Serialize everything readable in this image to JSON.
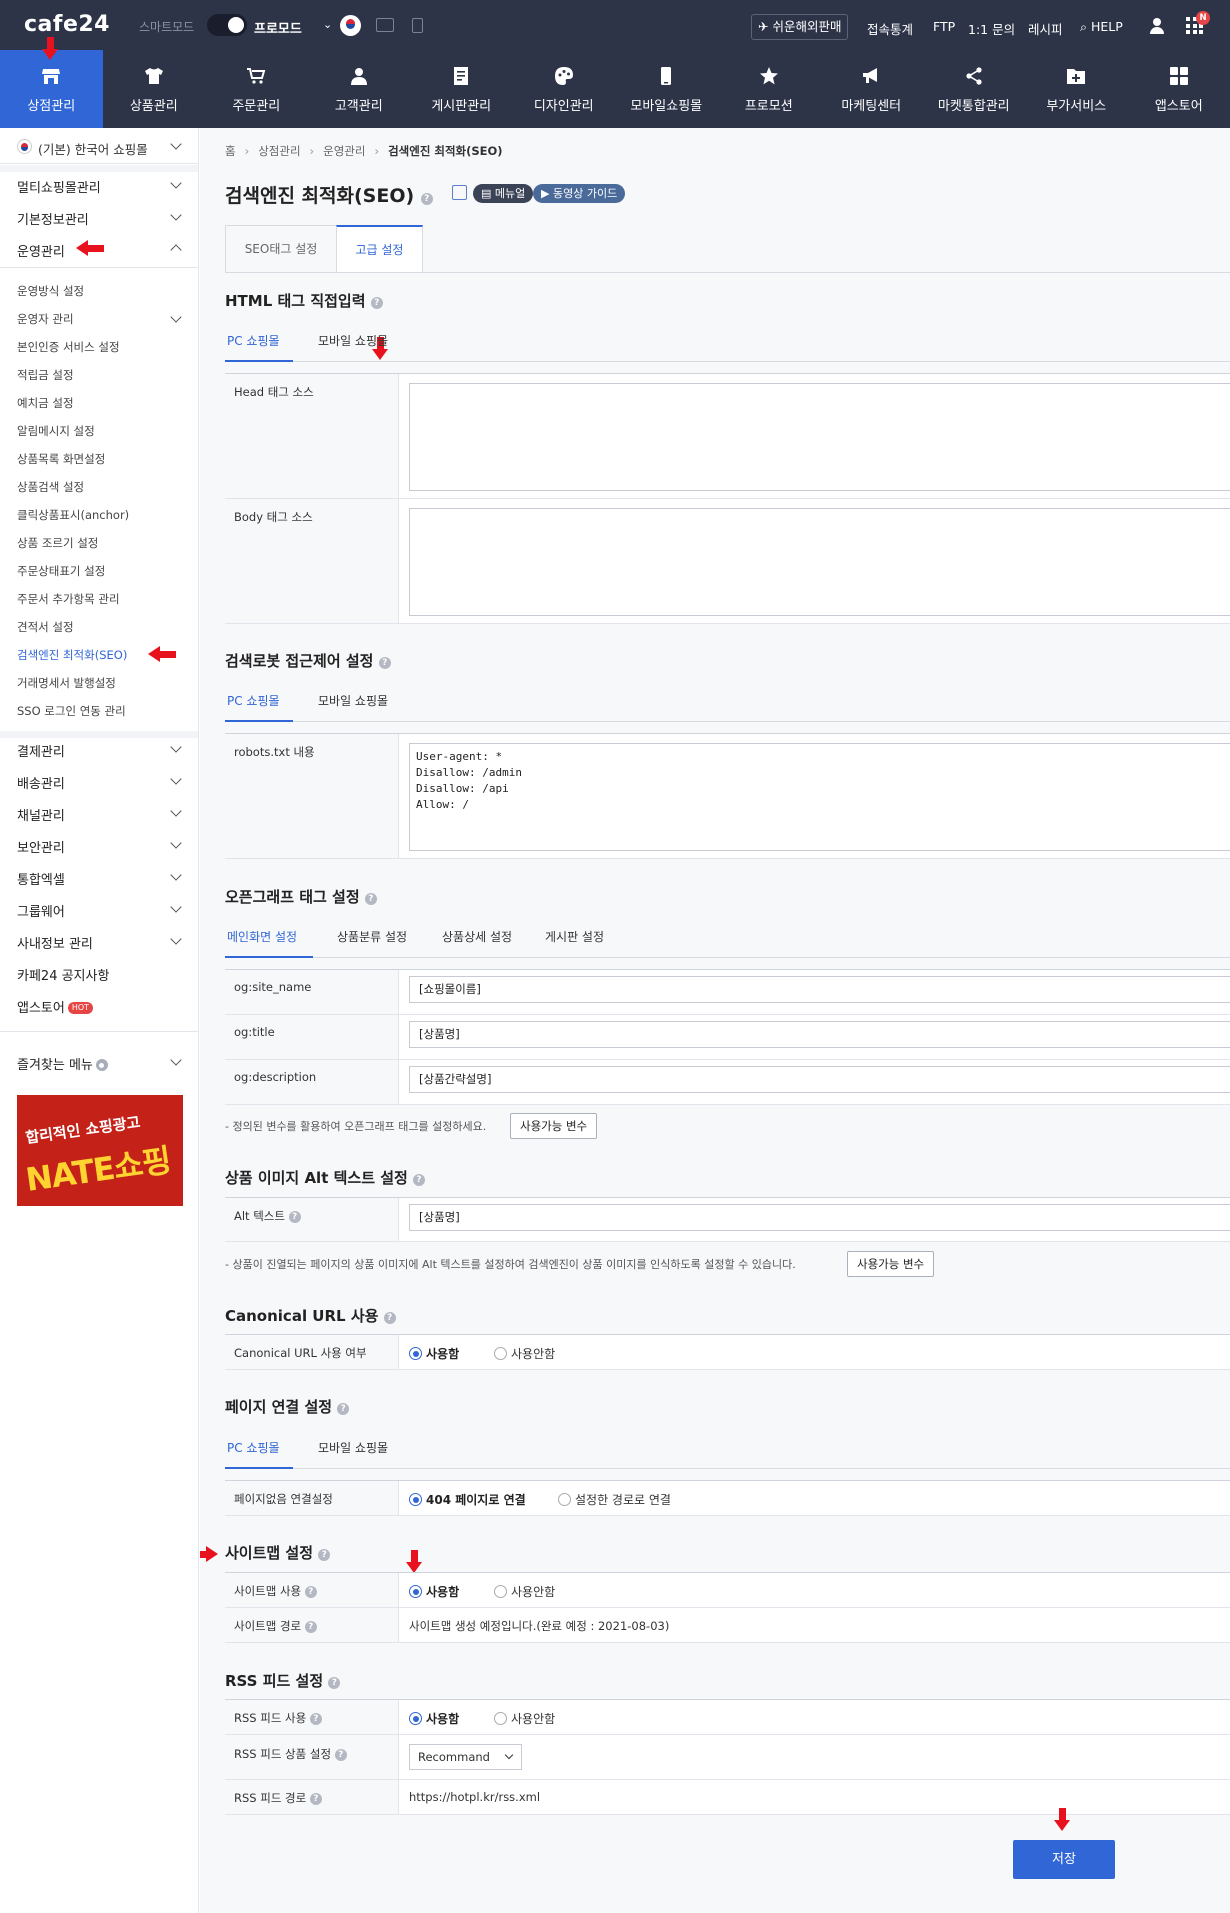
{
  "topbar": {
    "logo": "cafe24",
    "smart_mode": "스마트모드",
    "pro_mode": "프로모드",
    "quick_sell": "쉬운해외판매",
    "links": [
      "접속통계",
      "FTP",
      "1:1 문의",
      "레시피",
      "HELP"
    ],
    "notification_badge": "N"
  },
  "nav": {
    "items": [
      {
        "label": "상점관리",
        "icon": "store-icon"
      },
      {
        "label": "상품관리",
        "icon": "shirt-icon"
      },
      {
        "label": "주문관리",
        "icon": "cart-icon"
      },
      {
        "label": "고객관리",
        "icon": "person-icon"
      },
      {
        "label": "게시판관리",
        "icon": "board-icon"
      },
      {
        "label": "디자인관리",
        "icon": "palette-icon"
      },
      {
        "label": "모바일쇼핑몰",
        "icon": "mobile-icon"
      },
      {
        "label": "프로모션",
        "icon": "star-icon"
      },
      {
        "label": "마케팅센터",
        "icon": "megaphone-icon"
      },
      {
        "label": "마켓통합관리",
        "icon": "share-icon"
      },
      {
        "label": "부가서비스",
        "icon": "folder-plus-icon"
      },
      {
        "label": "앱스토어",
        "icon": "apps-icon"
      }
    ]
  },
  "sidebar": {
    "shop_select": "(기본) 한국어 쇼핑몰",
    "menus_top": [
      "멀티쇼핑몰관리",
      "기본정보관리",
      "운영관리"
    ],
    "sub_items": [
      "운영방식 설정",
      "운영자 관리",
      "본인인증 서비스 설정",
      "적립금 설정",
      "예치금 설정",
      "알림메시지 설정",
      "상품목록 화면설정",
      "상품검색 설정",
      "클릭상품표시(anchor)",
      "상품 조르기 설정",
      "주문상태표기 설정",
      "주문서 추가항목 관리",
      "견적서 설정",
      "검색엔진 최적화(SEO)",
      "거래명세서 발행설정",
      "SSO 로그인 연동 관리"
    ],
    "menus_bottom": [
      "결제관리",
      "배송관리",
      "채널관리",
      "보안관리",
      "통합엑셀",
      "그룹웨어",
      "사내정보 관리",
      "카페24 공지사항",
      "앱스토어"
    ],
    "hot_badge": "HOT",
    "favorites": "즐겨찾는 메뉴",
    "banner_line1": "합리적인 쇼핑광고",
    "banner_line2": "NATE쇼핑"
  },
  "breadcrumb": [
    "홈",
    "상점관리",
    "운영관리",
    "검색엔진 최적화(SEO)"
  ],
  "page": {
    "title": "검색엔진 최적화(SEO)",
    "manual_pill": "메뉴얼",
    "video_pill": "동영상 가이드",
    "tabs": [
      "SEO태그 설정",
      "고급 설정"
    ]
  },
  "html_tag": {
    "title": "HTML 태그 직접입력",
    "subtabs": [
      "PC 쇼핑몰",
      "모바일 쇼핑몰"
    ],
    "head_label": "Head 태그 소스",
    "head_value": "",
    "body_label": "Body 태그 소스",
    "body_value": ""
  },
  "robots": {
    "title": "검색로봇 접근제어 설정",
    "subtabs": [
      "PC 쇼핑몰",
      "모바일 쇼핑몰"
    ],
    "label": "robots.txt 내용",
    "content": "User-agent: *\nDisallow: /admin\nDisallow: /api\nAllow: /"
  },
  "opengraph": {
    "title": "오픈그래프 태그 설정",
    "subtabs": [
      "메인화면 설정",
      "상품분류 설정",
      "상품상세 설정",
      "게시판 설정"
    ],
    "rows": [
      {
        "label": "og:site_name",
        "value": "[쇼핑몰이름]"
      },
      {
        "label": "og:title",
        "value": "[상품명]"
      },
      {
        "label": "og:description",
        "value": "[상품간략설명]"
      }
    ],
    "note": "- 정의된 변수를 활용하여 오픈그래프 태그를 설정하세요.",
    "var_button": "사용가능 변수"
  },
  "alt_text": {
    "title": "상품 이미지 Alt 텍스트 설정",
    "label": "Alt 텍스트",
    "value": "[상품명]",
    "note": "- 상품이 진열되는 페이지의 상품 이미지에 Alt 텍스트를 설정하여 검색엔진이 상품 이미지를 인식하도록 설정할 수 있습니다.",
    "var_button": "사용가능 변수"
  },
  "canonical": {
    "title": "Canonical URL 사용",
    "label": "Canonical URL 사용 여부",
    "options": [
      "사용함",
      "사용안함"
    ],
    "selected": 0
  },
  "page_link": {
    "title": "페이지 연결 설정",
    "subtabs": [
      "PC 쇼핑몰",
      "모바일 쇼핑몰"
    ],
    "label": "페이지없음 연결설정",
    "options": [
      "404 페이지로 연결",
      "설정한 경로로 연결"
    ],
    "selected": 0
  },
  "sitemap": {
    "title": "사이트맵 설정",
    "use_label": "사이트맵 사용",
    "options": [
      "사용함",
      "사용안함"
    ],
    "selected": 0,
    "path_label": "사이트맵 경로",
    "path_value": "사이트맵 생성 예정입니다.(완료 예정 : 2021-08-03)"
  },
  "rss": {
    "title": "RSS 피드 설정",
    "use_label": "RSS 피드 사용",
    "options": [
      "사용함",
      "사용안함"
    ],
    "selected": 0,
    "product_label": "RSS 피드 상품 설정",
    "product_value": "Recommand",
    "path_label": "RSS 피드 경로",
    "path_value": "https://hotpl.kr/rss.xml"
  },
  "save_button": "저장",
  "colors": {
    "topbar": "#2e3448",
    "accent": "#3166d6",
    "annotation_arrow": "#e8121e"
  }
}
